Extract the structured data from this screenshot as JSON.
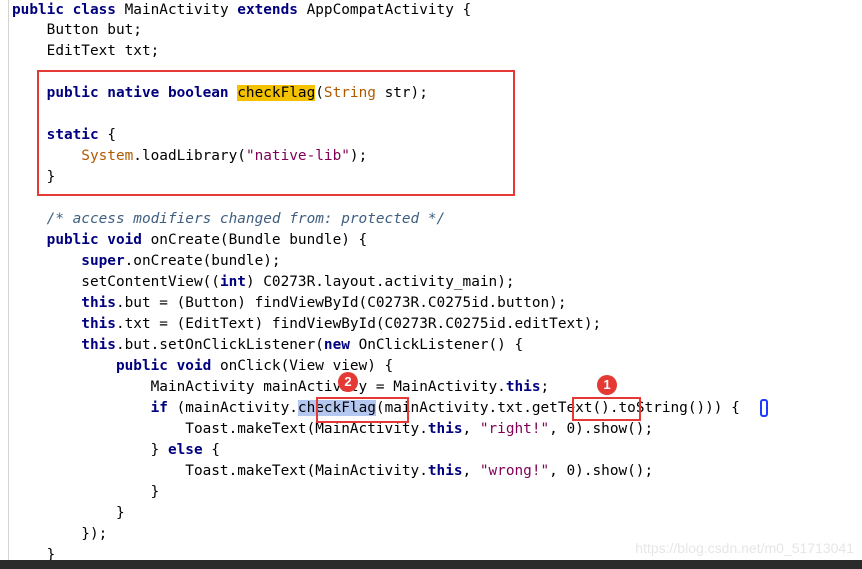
{
  "editor": {
    "lines": [
      [
        {
          "t": "public class ",
          "c": "kw"
        },
        {
          "t": "MainActivity ",
          "c": "cls"
        },
        {
          "t": "extends ",
          "c": "kw"
        },
        {
          "t": "AppCompatActivity {",
          "c": "cls"
        }
      ],
      [
        {
          "t": "    Button but;",
          "c": "cls"
        }
      ],
      [
        {
          "t": "    EditText txt;",
          "c": "cls"
        }
      ],
      [],
      [
        {
          "t": "    public native boolean ",
          "c": "kw"
        },
        {
          "t": "checkFlag",
          "c": "cls hl-yellow"
        },
        {
          "t": "(",
          "c": "cls"
        },
        {
          "t": "String",
          "c": "orange"
        },
        {
          "t": " str);",
          "c": "cls"
        }
      ],
      [],
      [
        {
          "t": "    static ",
          "c": "kw"
        },
        {
          "t": "{",
          "c": "cls"
        }
      ],
      [
        {
          "t": "        System",
          "c": "orange"
        },
        {
          "t": ".loadLibrary(",
          "c": "cls"
        },
        {
          "t": "\"native-lib\"",
          "c": "strname"
        },
        {
          "t": ");",
          "c": "cls"
        }
      ],
      [
        {
          "t": "    }",
          "c": "cls"
        }
      ],
      [],
      [
        {
          "t": "    /* access modifiers changed from: protected */",
          "c": "cmt"
        }
      ],
      [
        {
          "t": "    public void ",
          "c": "kw"
        },
        {
          "t": "onCreate(Bundle bundle) {",
          "c": "cls"
        }
      ],
      [
        {
          "t": "        super",
          "c": "kw"
        },
        {
          "t": ".onCreate(bundle);",
          "c": "cls"
        }
      ],
      [
        {
          "t": "        setContentView((",
          "c": "cls"
        },
        {
          "t": "int",
          "c": "kw"
        },
        {
          "t": ") C0273R.layout.activity_main);",
          "c": "cls"
        }
      ],
      [
        {
          "t": "        this",
          "c": "kw"
        },
        {
          "t": ".but = (Button) findViewById(C0273R.C0275id.button);",
          "c": "cls"
        }
      ],
      [
        {
          "t": "        this",
          "c": "kw"
        },
        {
          "t": ".txt = (EditText) findViewById(C0273R.C0275id.editText);",
          "c": "cls"
        }
      ],
      [
        {
          "t": "        this",
          "c": "kw"
        },
        {
          "t": ".but.setOnClickListener(",
          "c": "cls"
        },
        {
          "t": "new ",
          "c": "kw"
        },
        {
          "t": "OnClickListener() {",
          "c": "cls"
        }
      ],
      [
        {
          "t": "            public void ",
          "c": "kw"
        },
        {
          "t": "onClick(View view) {",
          "c": "cls"
        }
      ],
      [
        {
          "t": "                MainActivity mainActivity = MainActivity.",
          "c": "cls"
        },
        {
          "t": "this",
          "c": "kw"
        },
        {
          "t": ";",
          "c": "cls"
        }
      ],
      [
        {
          "t": "                if ",
          "c": "kw"
        },
        {
          "t": "(mainActivity.",
          "c": "cls"
        },
        {
          "t": "checkFlag",
          "c": "cls hl-blue"
        },
        {
          "t": "(mainActivity.txt.",
          "c": "cls"
        },
        {
          "t": "getText",
          "c": "cls"
        },
        {
          "t": "().toString())) {",
          "c": "cls"
        }
      ],
      [
        {
          "t": "                    Toast.makeText(MainActivity.",
          "c": "cls"
        },
        {
          "t": "this",
          "c": "kw"
        },
        {
          "t": ", ",
          "c": "cls"
        },
        {
          "t": "\"right!\"",
          "c": "strname"
        },
        {
          "t": ", 0).show();",
          "c": "cls"
        }
      ],
      [
        {
          "t": "                } ",
          "c": "cls"
        },
        {
          "t": "else ",
          "c": "kw"
        },
        {
          "t": "{",
          "c": "cls"
        }
      ],
      [
        {
          "t": "                    Toast.makeText(MainActivity.",
          "c": "cls"
        },
        {
          "t": "this",
          "c": "kw"
        },
        {
          "t": ", ",
          "c": "cls"
        },
        {
          "t": "\"wrong!\"",
          "c": "strname"
        },
        {
          "t": ", 0).show();",
          "c": "cls"
        }
      ],
      [
        {
          "t": "                }",
          "c": "cls"
        }
      ],
      [
        {
          "t": "            }",
          "c": "cls"
        }
      ],
      [
        {
          "t": "        });",
          "c": "cls"
        }
      ],
      [
        {
          "t": "    }",
          "c": "cls"
        }
      ]
    ]
  },
  "annotations": {
    "badge_1": "1",
    "badge_2": "2"
  },
  "watermark": "https://blog.csdn.net/m0_51713041",
  "colors": {
    "keyword": "#00007f",
    "string": "#7f0055",
    "comment": "#3f5f7f",
    "highlight_yellow": "#f5c200",
    "highlight_blue": "#b3c7f0",
    "annotation_red": "#e53935"
  }
}
